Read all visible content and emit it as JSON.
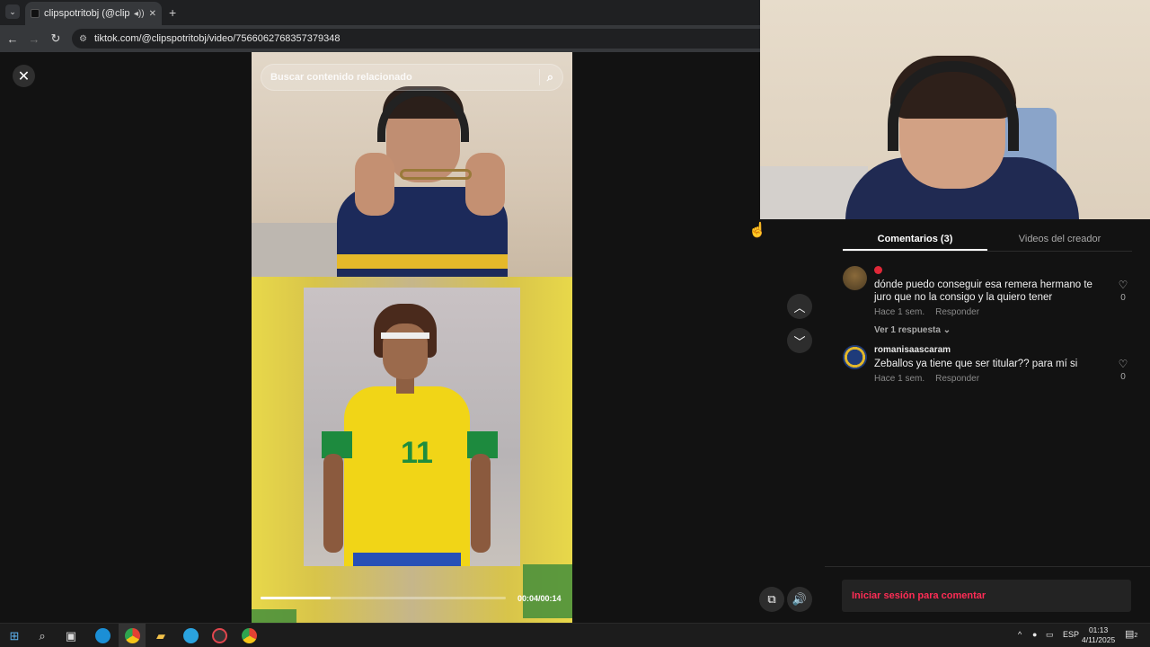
{
  "browser": {
    "tab_title": "clipspotritobj (@clipspotrit",
    "tab_sound_icon": "speaker-icon",
    "new_tab": "+",
    "url": "tiktok.com/@clipspotritobj/video/7566062768357379348"
  },
  "video": {
    "search_placeholder": "Buscar contenido relacionado",
    "jersey_number": "11",
    "time": "00:04/00:14",
    "progress": 0.285
  },
  "comments_panel": {
    "tabs": [
      {
        "label": "Comentarios (3)",
        "active": true
      },
      {
        "label": "Videos del creador",
        "active": false
      }
    ],
    "comments": [
      {
        "user": "",
        "text": "dónde puedo conseguir esa remera hermano te juro que no la consigo y la quiero tener",
        "time": "Hace 1 sem.",
        "reply": "Responder",
        "likes": "0",
        "replies": "Ver 1 respuesta"
      },
      {
        "user": "romanisaascaram",
        "text": "Zeballos ya tiene que ser titular?? para mí si",
        "time": "Hace 1 sem.",
        "reply": "Responder",
        "likes": "0"
      }
    ],
    "login_prompt": "Iniciar sesión para comentar"
  },
  "taskbar": {
    "language": "ESP",
    "time": "01:13",
    "date": "4/11/2025",
    "notifications": "2"
  },
  "colors": {
    "accent": "#fe2c55",
    "panel_bg": "#121212"
  }
}
